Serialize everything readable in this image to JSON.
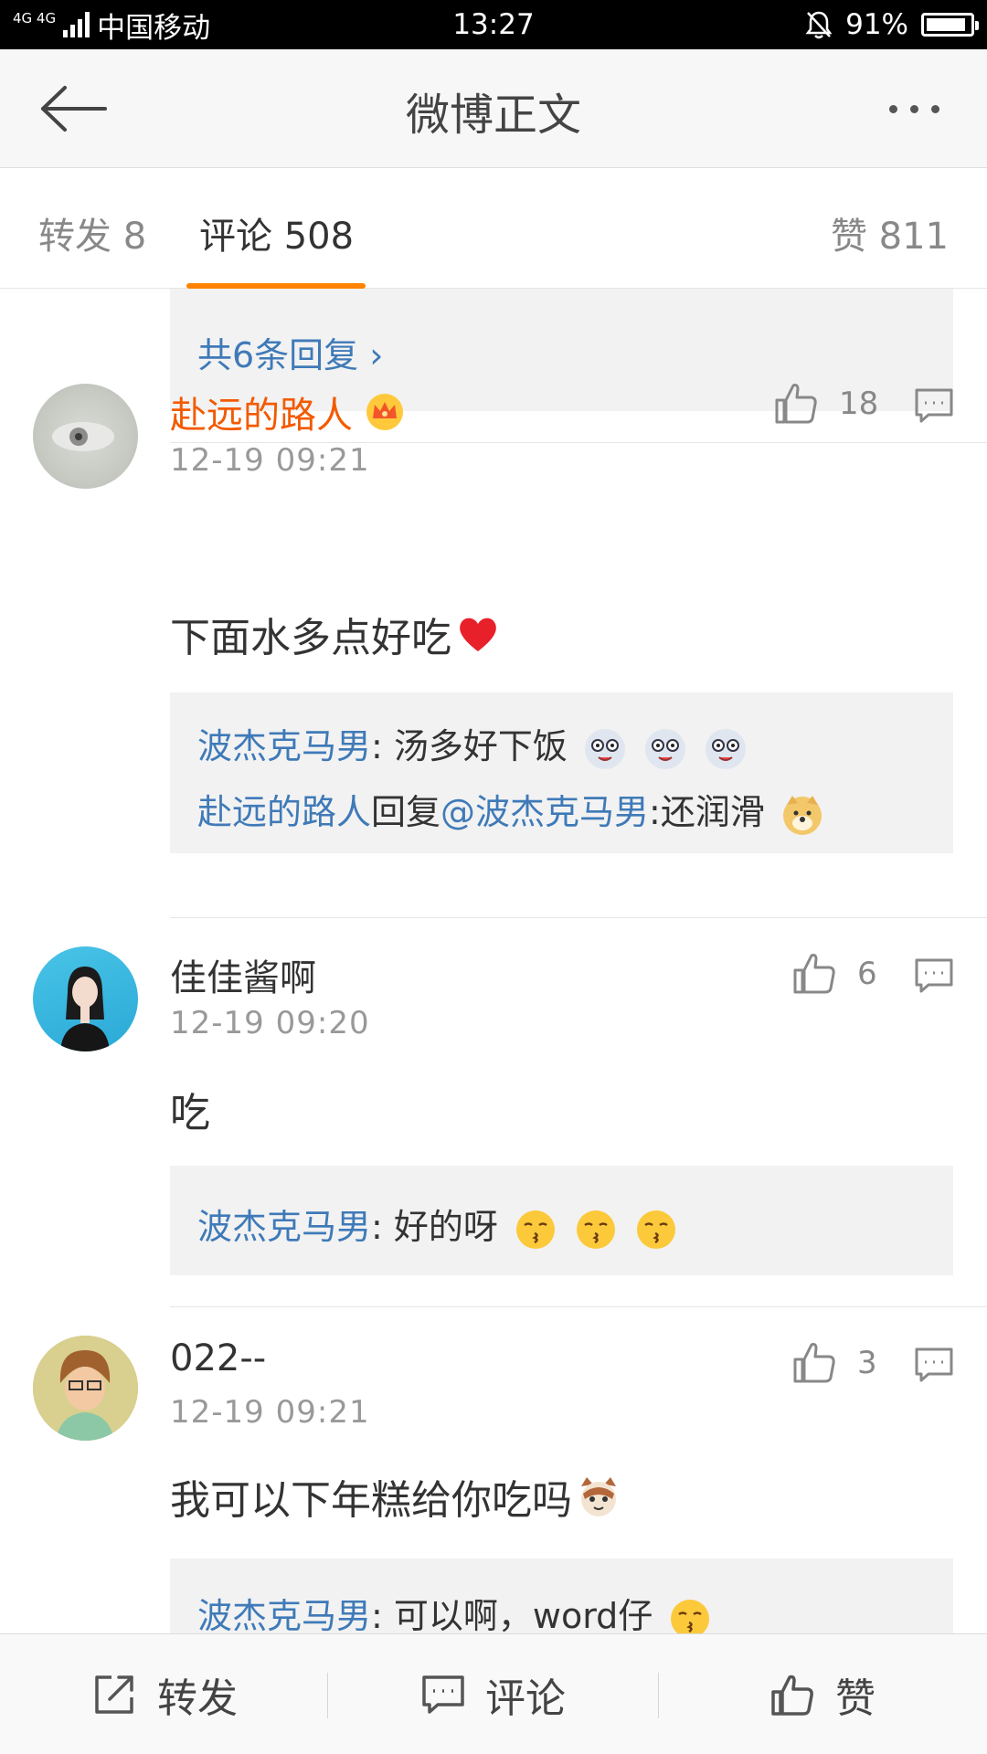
{
  "status_bar": {
    "network": "4G 4G",
    "carrier": "中国移动",
    "time": "13:27",
    "battery": "91%",
    "battery_level": 0.91
  },
  "nav": {
    "title": "微博正文",
    "back_icon": "arrow-left-icon",
    "more_icon": "more-dots-icon"
  },
  "tabs": {
    "repost": "转发 8",
    "comments": "评论 508",
    "likes": "赞 811",
    "active": "comments",
    "accent_color": "#ff8200"
  },
  "top_reply": {
    "more_replies": "共6条回复 ›"
  },
  "comments": [
    {
      "username": "赴远的路人",
      "has_crown": true,
      "time": "12-19 09:21",
      "text": "下面水多点好吃",
      "likes": "18",
      "replies": [
        {
          "user": "波杰克马男",
          "text": ": 汤多好下饭"
        },
        {
          "user": "赴远的路人",
          "mid": "回复",
          "at": "@波杰克马男",
          "text": ":还润滑"
        }
      ]
    },
    {
      "username": "佳佳酱啊",
      "time": "12-19 09:20",
      "text": "吃",
      "likes": "6",
      "replies": [
        {
          "user": "波杰克马男",
          "text": ": 好的呀"
        }
      ]
    },
    {
      "username": "022--",
      "time": "12-19 09:21",
      "text": "我可以下年糕给你吃吗",
      "likes": "3",
      "replies": [
        {
          "user": "波杰克马男",
          "text": ": 可以啊，word仔"
        }
      ]
    }
  ],
  "bottom_bar": {
    "repost": "转发",
    "comment": "评论",
    "like": "赞"
  },
  "colors": {
    "link": "#3f7ab8",
    "username_vip": "#f35a00",
    "reply_bg": "#f2f2f2"
  }
}
